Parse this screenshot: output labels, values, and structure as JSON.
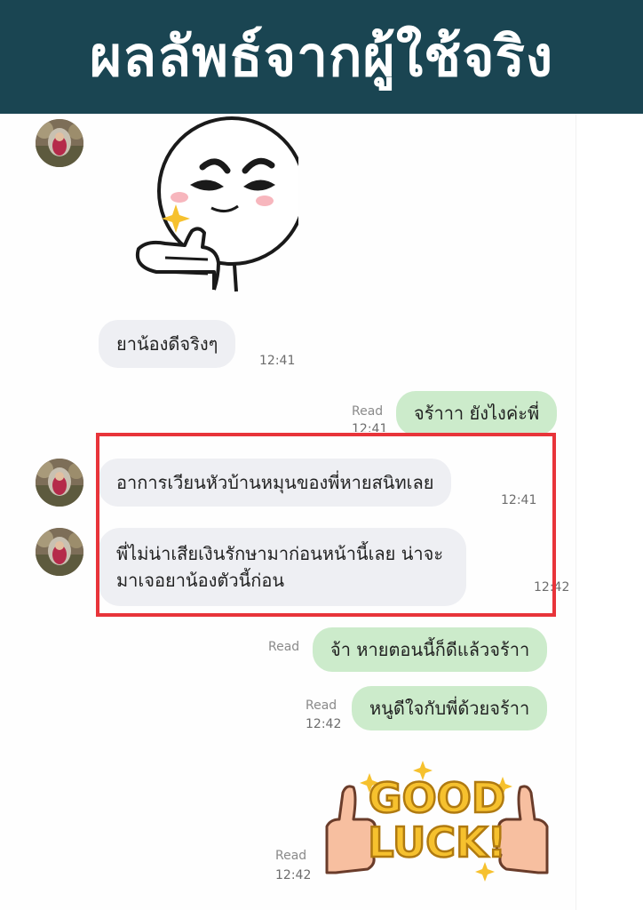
{
  "header": {
    "title": "ผลลัพธ์จากผู้ใช้จริง"
  },
  "messages": [
    {
      "type": "sticker",
      "name": "thumbs-up-face-sticker",
      "time": ""
    },
    {
      "type": "text",
      "side": "in",
      "text": "ยาน้องดีจริงๆ",
      "time": "12:41"
    },
    {
      "type": "text",
      "side": "out",
      "text": "จร้าาา ยังไงค่ะพี่",
      "read": "Read",
      "time": "12:41"
    },
    {
      "type": "text",
      "side": "in",
      "text": "อาการเวียนหัวบ้านหมุนของพี่หายสนิทเลย",
      "time": "12:41"
    },
    {
      "type": "text",
      "side": "in",
      "line1": "พี่ไม่น่าเสียเงินรักษามาก่อนหน้านี้เลย น่าจะ",
      "line2": "มาเจอยาน้องตัวนี้ก่อน",
      "time": "12:42"
    },
    {
      "type": "text",
      "side": "out",
      "text": "จ้า หายตอนนี้ก็ดีแล้วจร้าา",
      "read": "Read",
      "time": ""
    },
    {
      "type": "text",
      "side": "out",
      "text": "หนูดีใจกับพี่ด้วยจร้าา",
      "read": "Read",
      "time": "12:42"
    },
    {
      "type": "sticker",
      "name": "good-luck-sticker",
      "line1": "GOOD",
      "line2": "LUCK!",
      "read": "Read",
      "time": "12:42"
    }
  ],
  "colors": {
    "header_bg": "#1a4552",
    "incoming_bubble": "#eeeff3",
    "outgoing_bubble": "#ccebcb",
    "highlight_border": "#e8343a"
  }
}
